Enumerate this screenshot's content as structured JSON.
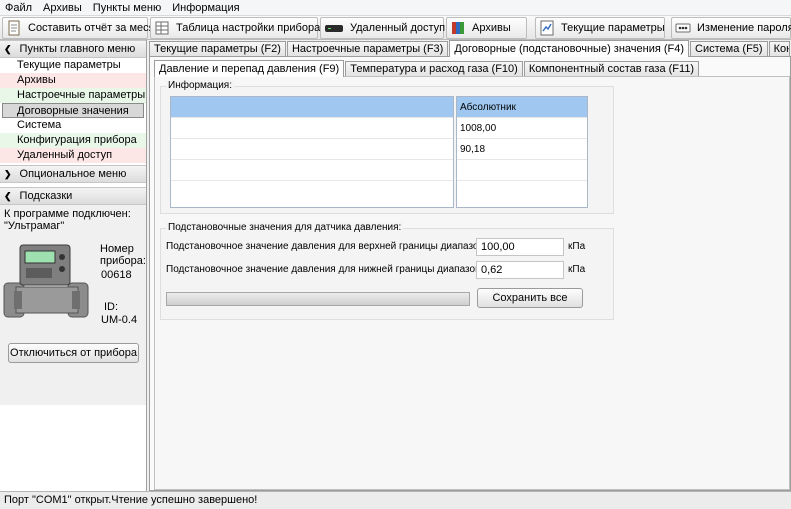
{
  "menu": [
    "Файл",
    "Архивы",
    "Пункты меню",
    "Информация"
  ],
  "toolbar": [
    {
      "label": "Составить отчёт за месяц",
      "icon": "report-icon"
    },
    {
      "label": "Таблица настройки прибора",
      "icon": "table-icon"
    },
    {
      "label": "Удаленный доступ",
      "icon": "modem-icon"
    },
    {
      "label": "Архивы",
      "icon": "archive-icon"
    },
    {
      "label": "Текущие параметры",
      "icon": "parameters-icon"
    },
    {
      "label": "Изменение пароля",
      "icon": "password-icon"
    }
  ],
  "sidebar": {
    "main_menu_header": "Пункты главного меню",
    "items": [
      {
        "label": "Текущие параметры",
        "bg": "#ffffff"
      },
      {
        "label": "Архивы",
        "bg": "#fde6e6"
      },
      {
        "label": "Настроечные параметры",
        "bg": "#e8f7e8"
      },
      {
        "label": "Договорные значения",
        "bg": "#d8d8d8"
      },
      {
        "label": "Система",
        "bg": "#ffffff"
      },
      {
        "label": "Конфигурация прибора",
        "bg": "#e8f7e8"
      },
      {
        "label": "Удаленный доступ",
        "bg": "#fde6e6"
      }
    ],
    "optional_header": "Опциональное меню",
    "hints_header": "Подсказки",
    "connected_label": "К программе подключен:",
    "device_name": "\"Ультрамаг\"",
    "number_label": "Номер прибора:",
    "number_value": "00618",
    "id_label": "ID:",
    "id_value": "UM-0.4",
    "disconnect_button": "Отключиться от прибора"
  },
  "tabs_main": [
    {
      "label": "Текущие параметры (F2)",
      "active": false
    },
    {
      "label": "Настроечные параметры (F3)",
      "active": false
    },
    {
      "label": "Договорные (подстановочные) значения (F4)",
      "active": true
    },
    {
      "label": "Система (F5)",
      "active": false
    },
    {
      "label": "Конфигурация пр",
      "active": false
    }
  ],
  "tabs_sub": [
    {
      "label": "Давление и перепад давления (F9)",
      "active": true
    },
    {
      "label": "Температура и расход газа (F10)",
      "active": false
    },
    {
      "label": "Компонентный состав газа (F11)",
      "active": false
    }
  ],
  "info_group": {
    "title": "Информация:",
    "right_rows": [
      "Абсолютник",
      "1008,00",
      "90,18",
      "",
      ""
    ]
  },
  "subst_group": {
    "title": "Подстановочные значения для датчика давления:",
    "upper_label": "Подстановочное значение давления для верхней границы диапазона:",
    "upper_value": "100,00",
    "lower_label": "Подстановочное значение давления для нижней границы диапазона :",
    "lower_value": "0,62",
    "unit": "кПа",
    "save_button": "Сохранить все",
    "progress": 0
  },
  "status": "Порт \"COM1\" открыт.Чтение успешно завершено!"
}
